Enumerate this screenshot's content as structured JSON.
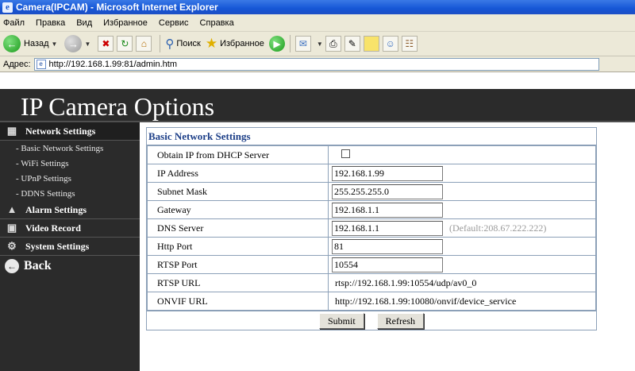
{
  "window": {
    "title": "Camera(IPCAM) - Microsoft Internet Explorer"
  },
  "menu": [
    "Файл",
    "Правка",
    "Вид",
    "Избранное",
    "Сервис",
    "Справка"
  ],
  "toolbar": {
    "back_label": "Назад",
    "search_label": "Поиск",
    "favorites_label": "Избранное"
  },
  "address": {
    "label": "Адрес:",
    "url": "http://192.168.1.99:81/admin.htm"
  },
  "banner": {
    "title": "IP Camera Options"
  },
  "sidebar": {
    "network": "Network Settings",
    "sub": [
      "- Basic Network Settings",
      "- WiFi Settings",
      "- UPnP Settings",
      "- DDNS Settings"
    ],
    "alarm": "Alarm Settings",
    "video": "Video Record",
    "system": "System Settings",
    "back": "Back"
  },
  "form": {
    "title": "Basic Network Settings",
    "rows": {
      "dhcp_label": "Obtain IP from DHCP Server",
      "ip_label": "IP Address",
      "ip_value": "192.168.1.99",
      "mask_label": "Subnet Mask",
      "mask_value": "255.255.255.0",
      "gateway_label": "Gateway",
      "gateway_value": "192.168.1.1",
      "dns_label": "DNS Server",
      "dns_value": "192.168.1.1",
      "dns_hint": "(Default:208.67.222.222)",
      "http_label": "Http Port",
      "http_value": "81",
      "rtsp_port_label": "RTSP Port",
      "rtsp_port_value": "10554",
      "rtsp_url_label": "RTSP URL",
      "rtsp_url_value": "rtsp://192.168.1.99:10554/udp/av0_0",
      "onvif_label": "ONVIF URL",
      "onvif_value": "http://192.168.1.99:10080/onvif/device_service"
    },
    "submit": "Submit",
    "refresh": "Refresh"
  },
  "icons": {
    "back": "back-arrow-icon",
    "forward": "forward-arrow-icon",
    "stop": "stop-icon",
    "refresh": "refresh-icon",
    "home": "home-icon",
    "search": "search-icon",
    "favorites": "star-icon",
    "media": "media-icon",
    "mail": "mail-icon",
    "print": "print-icon",
    "edit": "edit-icon",
    "notes": "notes-icon",
    "messenger": "messenger-icon",
    "research": "research-icon"
  },
  "colors": {
    "titlebar": "#1556d6",
    "sidebar": "#2b2b2b",
    "panel_title": "#1d3f88"
  }
}
